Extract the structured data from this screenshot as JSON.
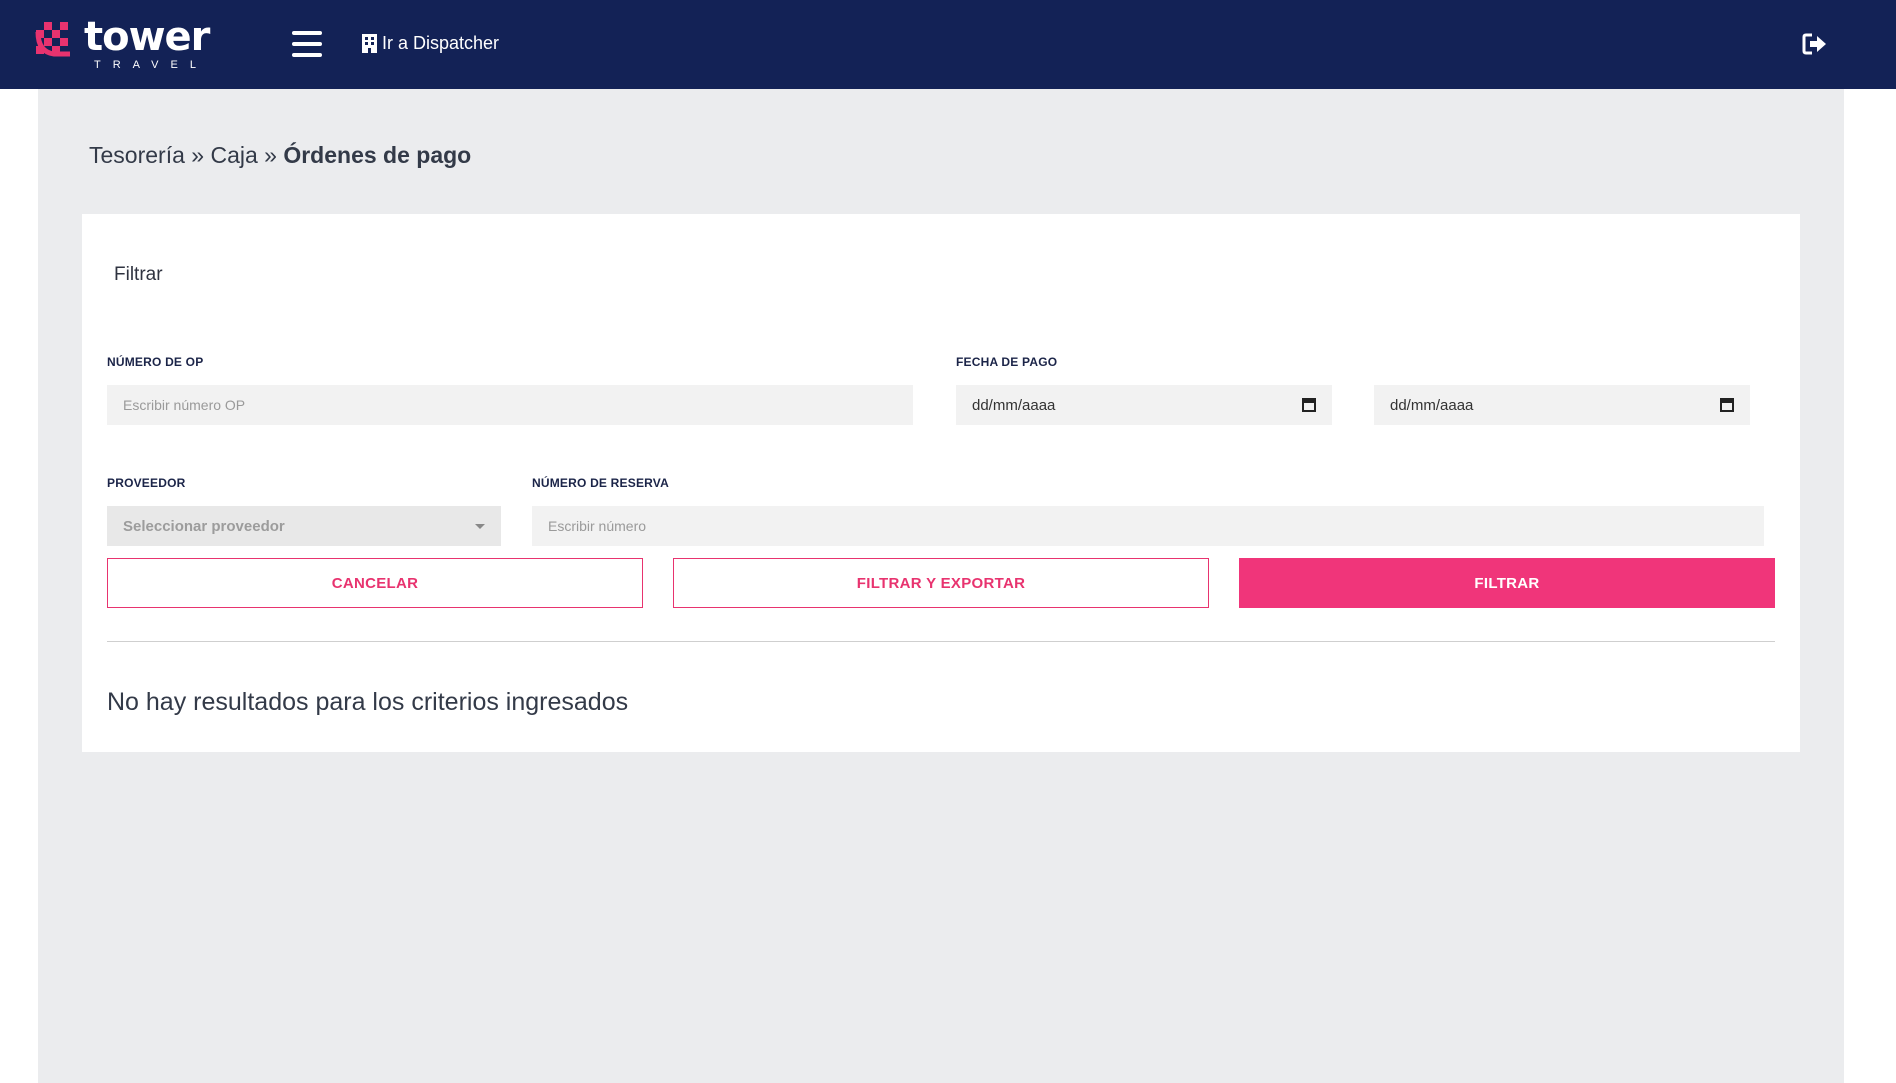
{
  "brand": {
    "name": "tower",
    "tagline": "TRAVEL",
    "accent": "#e8336f",
    "navbar_bg": "#132256"
  },
  "header": {
    "dispatcher_label": "Ir a Dispatcher"
  },
  "breadcrumb": {
    "level1": "Tesorería",
    "sep": "»",
    "level2": "Caja",
    "current": "Órdenes de pago"
  },
  "filter": {
    "title": "Filtrar",
    "op_number": {
      "label": "NÚMERO DE OP",
      "placeholder": "Escribir número OP"
    },
    "payment_date": {
      "label": "FECHA DE PAGO",
      "from_placeholder": "dd/mm/aaaa",
      "to_placeholder": "dd/mm/aaaa"
    },
    "provider": {
      "label": "PROVEEDOR",
      "selected": "Seleccionar proveedor"
    },
    "reservation": {
      "label": "NÚMERO DE RESERVA",
      "placeholder": "Escribir número"
    }
  },
  "buttons": {
    "cancel": "CANCELAR",
    "filter_export": "FILTRAR Y EXPORTAR",
    "filter": "FILTRAR"
  },
  "results": {
    "empty_message": "No hay resultados para los criterios ingresados"
  },
  "icons": [
    "brand-logo-icon",
    "hamburger-menu-icon",
    "building-icon",
    "logout-icon",
    "calendar-icon",
    "chevron-down-icon"
  ]
}
